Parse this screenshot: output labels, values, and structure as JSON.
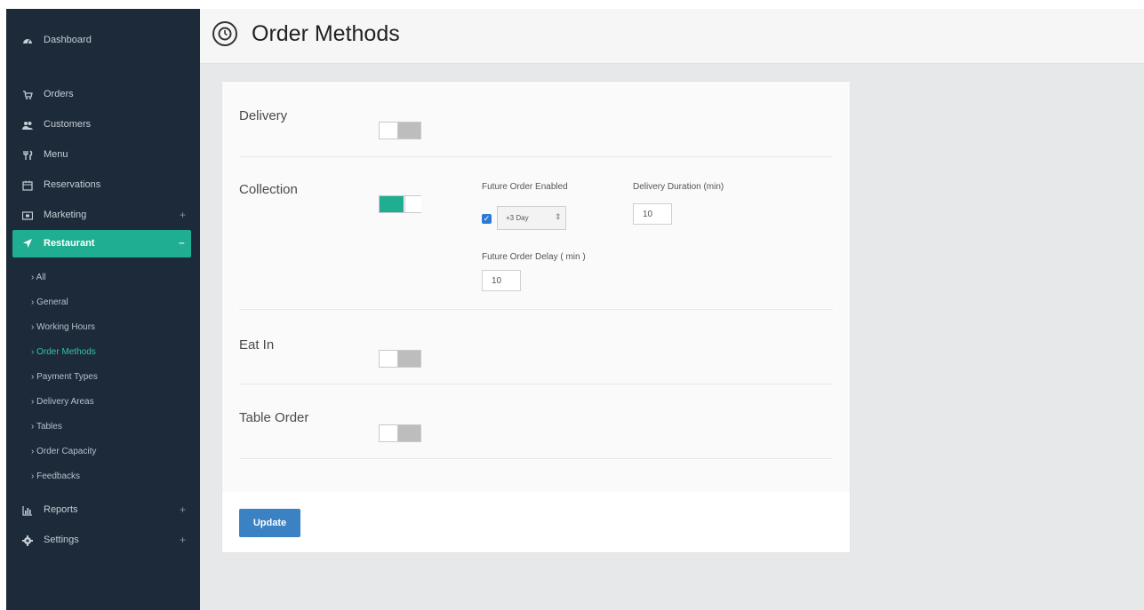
{
  "header": {
    "title": "Order Methods",
    "icon": "clock-icon"
  },
  "sidebar": {
    "dashboard": {
      "label": "Dashboard",
      "icon": "dashboard-icon"
    },
    "items": [
      {
        "label": "Orders",
        "icon": "cart-icon"
      },
      {
        "label": "Customers",
        "icon": "users-icon"
      },
      {
        "label": "Menu",
        "icon": "cutlery-icon"
      },
      {
        "label": "Reservations",
        "icon": "calendar-icon"
      },
      {
        "label": "Marketing",
        "icon": "megaphone-icon",
        "expand": "+"
      }
    ],
    "active": {
      "label": "Restaurant",
      "icon": "location-arrow-icon",
      "collapse": "–"
    },
    "subitems": [
      {
        "label": "All"
      },
      {
        "label": "General"
      },
      {
        "label": "Working Hours"
      },
      {
        "label": "Order Methods"
      },
      {
        "label": "Payment Types"
      },
      {
        "label": "Delivery Areas"
      },
      {
        "label": "Tables"
      },
      {
        "label": "Order Capacity"
      },
      {
        "label": "Feedbacks"
      }
    ],
    "bottom": [
      {
        "label": "Reports",
        "icon": "bar-chart-icon",
        "expand": "+"
      },
      {
        "label": "Settings",
        "icon": "gear-icon",
        "expand": "+"
      }
    ]
  },
  "methods": {
    "delivery": {
      "label": "Delivery",
      "enabled": false
    },
    "collection": {
      "label": "Collection",
      "enabled": true,
      "future_order_label": "Future Order Enabled",
      "future_order_checked": true,
      "future_order_select": "+3 Day",
      "delivery_duration_label": "Delivery Duration (min)",
      "delivery_duration_value": "10",
      "future_delay_label": "Future Order Delay ( min )",
      "future_delay_value": "10"
    },
    "eat_in": {
      "label": "Eat In",
      "enabled": false
    },
    "table_order": {
      "label": "Table Order",
      "enabled": false
    }
  },
  "actions": {
    "update_label": "Update"
  },
  "colors": {
    "sidebar": "#1c2a3a",
    "accent": "#1fae91",
    "primary_button": "#3b82c4"
  }
}
